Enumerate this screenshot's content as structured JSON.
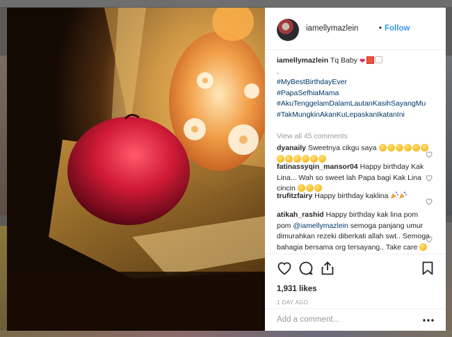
{
  "post": {
    "username": "iamellymazlein",
    "separator": "•",
    "follow_label": "Follow",
    "caption": {
      "text": "Tq Baby",
      "dot_line": ".",
      "hashtags": [
        "#MyBestBirthdayEver",
        "#PapaSefhiaMama",
        "#AkuTenggelamDalamLautanKasihSayangMu",
        "#TakMungkinAkanKuLepaskanIkatanIni"
      ]
    },
    "view_all_label": "View all 45 comments",
    "comments": [
      {
        "user": "dyanaily",
        "text": "Sweetnya cikgu saya"
      },
      {
        "user": "fatinassyqin_mansor04",
        "text": "Happy birthday Kak Lina... Wah so sweet lah Papa bagi Kak Lina cincin"
      },
      {
        "user": "trufitzfairy",
        "text": "Happy birthday kaklina"
      },
      {
        "user": "atikah_rashid",
        "text_before": "Happy birthday kak lina pom pom",
        "mention": "@iamellymazlein",
        "text_after": "semoga panjang umur dimurahkan rezeki diberkati allah swt.. Semoga bahagia bersama org tersayang.. Take care"
      }
    ],
    "likes": "1,931 likes",
    "time_ago": "1 DAY AGO",
    "add_comment_placeholder": "Add a comment...",
    "more_label": "•••"
  },
  "icons": [
    "like-heart-icon",
    "comment-icon",
    "share-icon",
    "save-bookmark-icon",
    "more-options-icon"
  ],
  "colors": {
    "link": "#3897f0",
    "hashtag": "#003569",
    "text": "#262626",
    "muted": "#999999"
  }
}
